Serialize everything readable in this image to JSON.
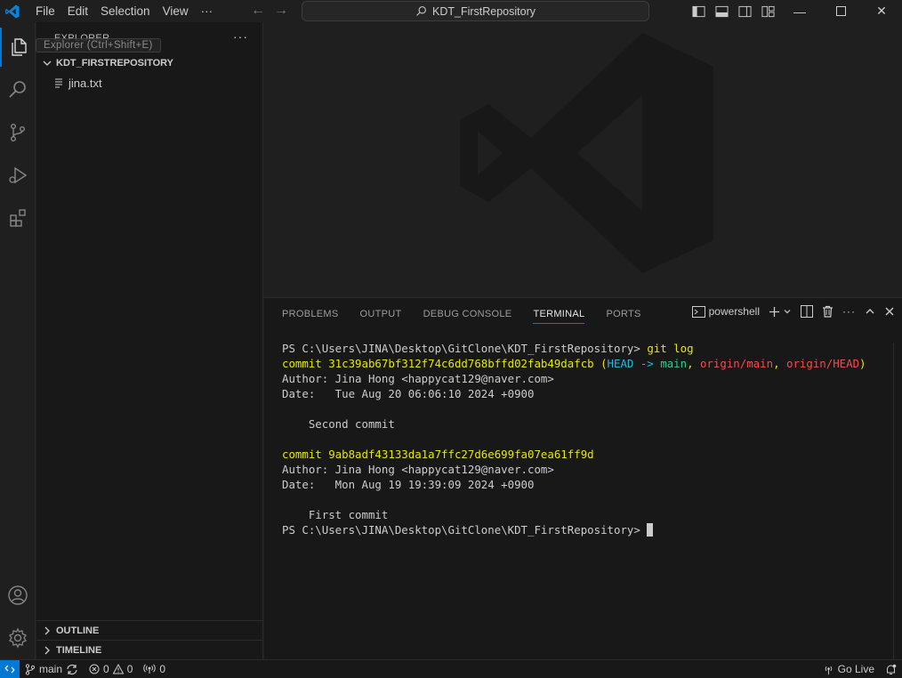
{
  "titlebar": {
    "menu": [
      "File",
      "Edit",
      "Selection",
      "View",
      "···"
    ],
    "search_text": "KDT_FirstRepository"
  },
  "sidebar": {
    "header": "EXPLORER",
    "tooltip": "Explorer (Ctrl+Shift+E)",
    "more": "···",
    "folder": "KDT_FIRSTREPOSITORY",
    "files": [
      "jina.txt"
    ],
    "outline": "OUTLINE",
    "timeline": "TIMELINE"
  },
  "panel": {
    "tabs": [
      "PROBLEMS",
      "OUTPUT",
      "DEBUG CONSOLE",
      "TERMINAL",
      "PORTS"
    ],
    "active_tab": "TERMINAL",
    "shell": "powershell",
    "terminal": {
      "prompt": "PS C:\\Users\\JINA\\Desktop\\GitClone\\KDT_FirstRepository>",
      "command": "git log",
      "commit1": {
        "label": "commit 31c39ab67bf312f74c6dd768bffd02fab49dafcb",
        "open": " (",
        "head": "HEAD -> ",
        "main": "main",
        "sep1": ", ",
        "origin_main": "origin/main",
        "sep2": ", ",
        "origin_head": "origin/HEAD",
        "close": ")",
        "author": "Author: Jina Hong <happycat129@naver.com>",
        "date": "Date:   Tue Aug 20 06:06:10 2024 +0900",
        "message": "    Second commit"
      },
      "commit2": {
        "label": "commit 9ab8adf43133da1a7ffc27d6e699fa07ea61ff9d",
        "author": "Author: Jina Hong <happycat129@naver.com>",
        "date": "Date:   Mon Aug 19 19:39:09 2024 +0900",
        "message": "    First commit"
      }
    }
  },
  "statusbar": {
    "branch": "main",
    "errors": "0",
    "warnings": "0",
    "ports": "0",
    "golive": "Go Live"
  },
  "colors": {
    "accent": "#0078d4",
    "commit": "#e5e510",
    "head": "#29b8db",
    "branch": "#23d18b",
    "remote": "#f14c4c"
  }
}
